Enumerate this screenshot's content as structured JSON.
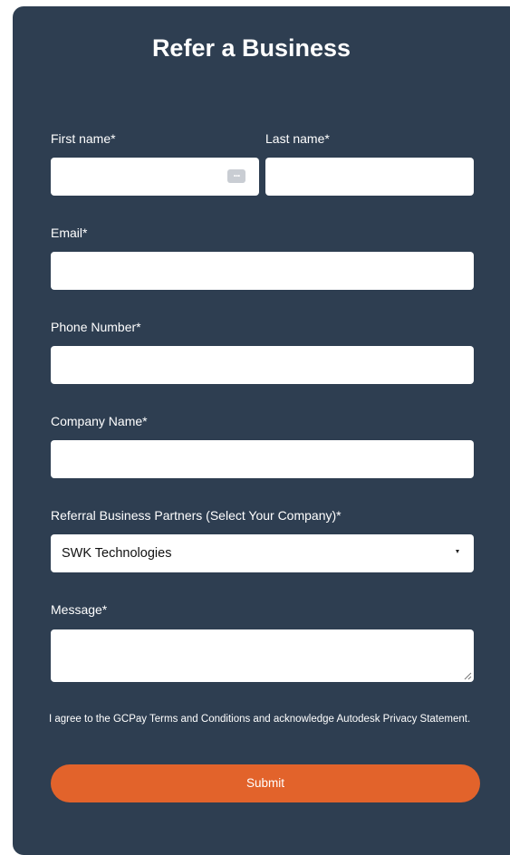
{
  "form": {
    "title": "Refer a Business",
    "fields": {
      "first_name": {
        "label": "First name*",
        "value": ""
      },
      "last_name": {
        "label": "Last name*",
        "value": ""
      },
      "email": {
        "label": "Email*",
        "value": ""
      },
      "phone": {
        "label": "Phone Number*",
        "value": ""
      },
      "company": {
        "label": "Company Name*",
        "value": ""
      },
      "partner": {
        "label": "Referral Business Partners (Select Your Company)*",
        "selected": "SWK Technologies"
      },
      "message": {
        "label": "Message*",
        "value": ""
      }
    },
    "consent_text": "I agree to the GCPay Terms and Conditions and acknowledge Autodesk Privacy Statement.",
    "submit_label": "Submit"
  },
  "icons": {
    "autofill": "autofill-icon",
    "select_arrow": "chevron-down-icon",
    "resize": "resize-handle-icon"
  },
  "colors": {
    "card_background": "#2e3e51",
    "submit_button": "#e2632b",
    "field_background": "#ffffff",
    "text": "#ffffff"
  }
}
